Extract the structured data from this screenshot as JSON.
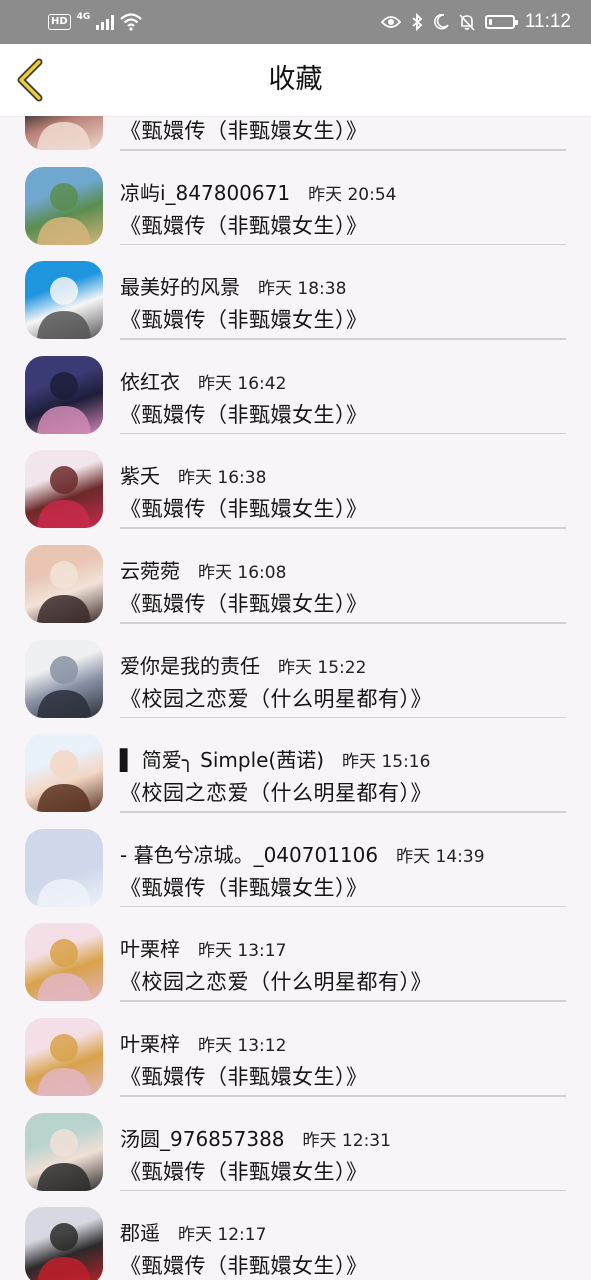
{
  "status_bar": {
    "hd": "HD",
    "network": "4G",
    "time": "11:12",
    "battery_level": 0.15,
    "icons": [
      "hd-badge-icon",
      "signal-icon",
      "wifi-icon",
      "eye-icon",
      "bluetooth-icon",
      "moon-icon",
      "bell-off-icon",
      "battery-icon"
    ]
  },
  "header": {
    "title": "收藏",
    "back_icon": "chevron-left-icon",
    "accent_color": "#f2cf2a"
  },
  "favorites": [
    {
      "name": "",
      "time": "",
      "title": "《甄嬛传（非甄嬛女生）》",
      "avatar_colors": [
        "#2a2a2a",
        "#f1dad0",
        "#b88078"
      ]
    },
    {
      "name": "凉屿i_847800671",
      "time": "昨天 20:54",
      "title": "《甄嬛传（非甄嬛女生）》",
      "avatar_colors": [
        "#6fa7cf",
        "#d6b57c",
        "#5b8d4e"
      ]
    },
    {
      "name": "最美好的风景",
      "time": "昨天 18:38",
      "title": "《甄嬛传（非甄嬛女生）》",
      "avatar_colors": [
        "#1f95e0",
        "#555555",
        "#f6f6f6"
      ]
    },
    {
      "name": "依红衣",
      "time": "昨天 16:42",
      "title": "《甄嬛传（非甄嬛女生）》",
      "avatar_colors": [
        "#3a3a74",
        "#d28bb5",
        "#1d1d3a"
      ]
    },
    {
      "name": "紫夭",
      "time": "昨天 16:38",
      "title": "《甄嬛传（非甄嬛女生）》",
      "avatar_colors": [
        "#f2e6ec",
        "#c9294a",
        "#6b2a2a"
      ]
    },
    {
      "name": "云菀菀",
      "time": "昨天 16:08",
      "title": "《甄嬛传（非甄嬛女生）》",
      "avatar_colors": [
        "#e8c6b3",
        "#3a2a2a",
        "#f2e3d8"
      ]
    },
    {
      "name": "爱你是我的责任",
      "time": "昨天 15:22",
      "title": "《校园之恋爱（什么明星都有）》",
      "avatar_colors": [
        "#eef0f2",
        "#2b2f3a",
        "#8a93a6"
      ]
    },
    {
      "name": "▌ 简爱╮ Simple(茜诺)",
      "time": "昨天 15:16",
      "title": "《校园之恋爱（什么明星都有）》",
      "avatar_colors": [
        "#e9f1fb",
        "#5a3322",
        "#f3d6c4"
      ]
    },
    {
      "name": "- 暮色兮凉城。_040701106",
      "time": "昨天 14:39",
      "title": "《甄嬛传（非甄嬛女生）》",
      "avatar_colors": [
        "#cfd8ea",
        "#eef2f9",
        "#cfd8ea"
      ]
    },
    {
      "name": "叶栗梓",
      "time": "昨天 13:17",
      "title": "《校园之恋爱（什么明星都有）》",
      "avatar_colors": [
        "#f4dfe6",
        "#e3b6c2",
        "#d8a24a"
      ]
    },
    {
      "name": "叶栗梓",
      "time": "昨天 13:12",
      "title": "《甄嬛传（非甄嬛女生）》",
      "avatar_colors": [
        "#f4dfe6",
        "#e3b6c2",
        "#d8a24a"
      ]
    },
    {
      "name": "汤圆_976857388",
      "time": "昨天 12:31",
      "title": "《甄嬛传（非甄嬛女生）》",
      "avatar_colors": [
        "#b9d3cf",
        "#2b2b2b",
        "#f0e0d6"
      ]
    },
    {
      "name": "郡遥",
      "time": "昨天 12:17",
      "title": "《甄嬛传（非甄嬛女生）》",
      "avatar_colors": [
        "#d8d8e2",
        "#c0202a",
        "#2a2a2a"
      ]
    }
  ]
}
